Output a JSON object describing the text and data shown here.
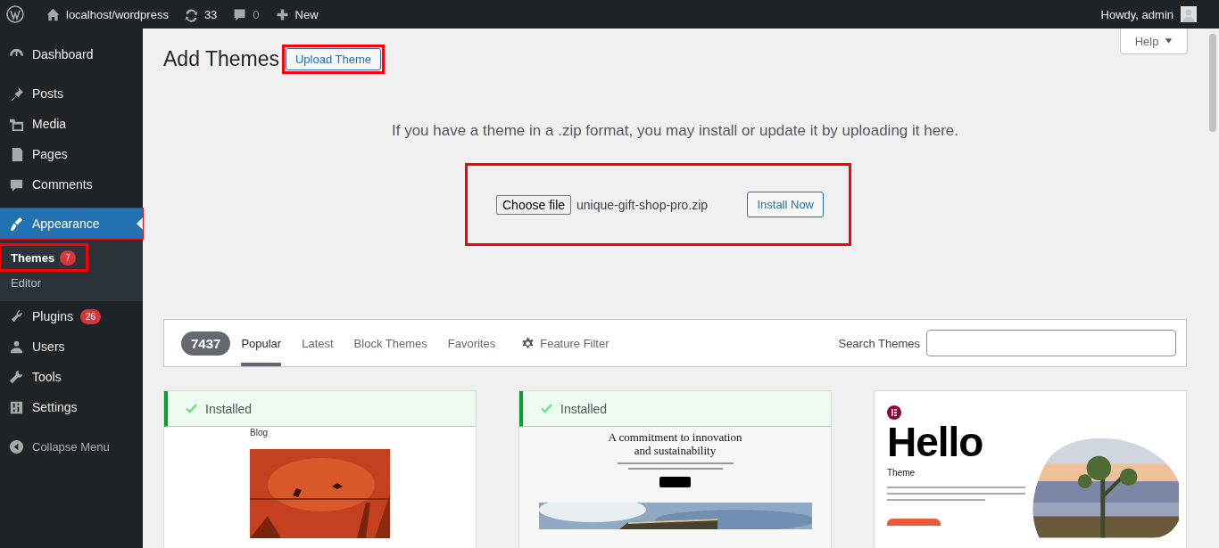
{
  "admin_bar": {
    "site": "localhost/wordpress",
    "updates": "33",
    "comments": "0",
    "new": "New",
    "greeting": "Howdy, admin"
  },
  "sidebar": {
    "groups": [
      {
        "items": [
          {
            "label": "Dashboard",
            "selected": false
          }
        ]
      },
      {
        "items": [
          {
            "label": "Posts",
            "selected": false
          },
          {
            "label": "Media",
            "selected": false
          },
          {
            "label": "Pages",
            "selected": false
          },
          {
            "label": "Comments",
            "selected": false
          }
        ]
      },
      {
        "items": [
          {
            "label": "Appearance",
            "selected": true,
            "highlighted": true,
            "children": [
              {
                "label": "Themes",
                "selected": true,
                "badge": "7",
                "highlighted": true
              },
              {
                "label": "Editor",
                "selected": false,
                "highlighted": false
              }
            ]
          },
          {
            "label": "Plugins",
            "selected": false,
            "badge": "26"
          },
          {
            "label": "Users",
            "selected": false
          },
          {
            "label": "Tools",
            "selected": false
          },
          {
            "label": "Settings",
            "selected": false
          }
        ]
      }
    ],
    "collapse": "Collapse Menu"
  },
  "help": "Help",
  "header": {
    "title": "Add Themes",
    "upload_button": "Upload Theme",
    "highlighted": true
  },
  "upload": {
    "intro": "If you have a theme in a .zip format, you may install or update it by uploading it here.",
    "choose_button": "Choose file",
    "file_name": "unique-gift-shop-pro.zip",
    "install_button": "Install Now",
    "highlighted": true
  },
  "filter_bar": {
    "count": "7437",
    "tabs": [
      {
        "label": "Popular",
        "selected": true
      },
      {
        "label": "Latest",
        "selected": false
      },
      {
        "label": "Block Themes",
        "selected": false
      },
      {
        "label": "Favorites",
        "selected": false
      }
    ],
    "feature_filter": "Feature Filter",
    "search_label": "Search Themes"
  },
  "themes": [
    {
      "kind": "blog",
      "installed": true,
      "installed_label": "Installed",
      "texts": [
        "Blog"
      ]
    },
    {
      "kind": "business",
      "installed": true,
      "installed_label": "Installed",
      "texts": [
        "A commitment to innovation",
        "and sustainability"
      ]
    },
    {
      "kind": "hello",
      "installed": false,
      "texts": [
        "Hello",
        "Theme"
      ]
    }
  ]
}
